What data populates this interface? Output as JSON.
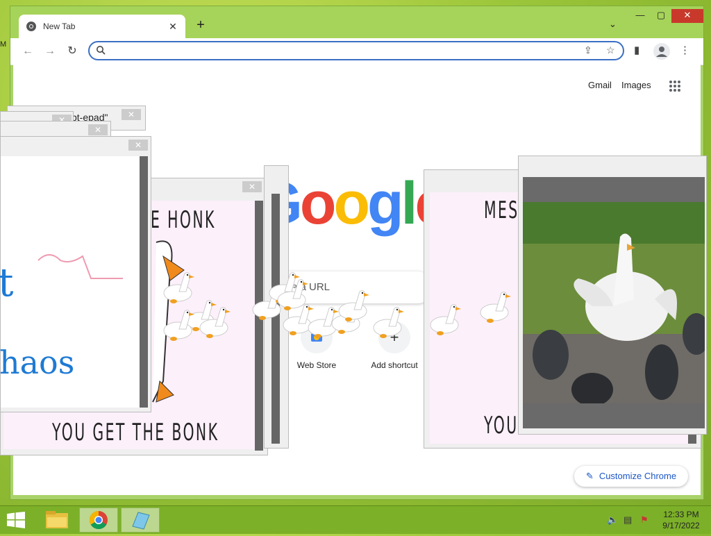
{
  "desktop": {
    "edge_label": "M"
  },
  "chrome": {
    "tab": {
      "title": "New Tab",
      "close": "✕",
      "icon": "chrome-icon"
    },
    "new_tab": "+",
    "tab_menu": "⌄",
    "window_controls": {
      "minimize": "—",
      "maximize": "▢",
      "close": "✕"
    },
    "toolbar": {
      "back": "←",
      "forward": "→",
      "reload": "↻",
      "omnibox_value": "",
      "share": "⇪",
      "bookmark": "☆",
      "side_panel": "▮",
      "menu": "⋮"
    },
    "page": {
      "links": {
        "gmail": "Gmail",
        "images": "Images"
      },
      "logo": [
        "G",
        "o",
        "o",
        "g",
        "l",
        "e"
      ],
      "logo_colors": [
        "#4285f4",
        "#ea4335",
        "#fbbc05",
        "#4285f4",
        "#34a853",
        "#ea4335"
      ],
      "search_placeholder": "e a URL",
      "shortcuts": [
        {
          "label": "Web Store",
          "icon": "web-store-icon"
        },
        {
          "label": "Add shortcut",
          "icon": "plus-icon",
          "glyph": "+"
        }
      ],
      "customize": {
        "icon": "pencil-icon",
        "label": "Customize Chrome",
        "glyph": "✎"
      }
    }
  },
  "notepads": {
    "title_fragment": "pt-epad\"",
    "close": "✕"
  },
  "drawing": {
    "words": [
      "t",
      "haos"
    ]
  },
  "memes": {
    "left": {
      "top_text": "E HONK",
      "bottom_text": "YOU GET THE BONK"
    },
    "right": {
      "top_text": "MESS",
      "bottom_text": "YOU GET THE BONK"
    }
  },
  "taskbar": {
    "apps": [
      "file-explorer-icon",
      "chrome-icon",
      "app-icon"
    ],
    "tray": {
      "volume": "🔈",
      "network": "▤",
      "flag": "⚑"
    },
    "clock": {
      "time": "12:33 PM",
      "date": "9/17/2022"
    }
  },
  "colors": {
    "accent": "#3b6fc4",
    "taskbar": "#7cb029",
    "window_frame": "#a6d35a",
    "close": "#c8392b",
    "meme_bg": "#fcf0fa"
  }
}
